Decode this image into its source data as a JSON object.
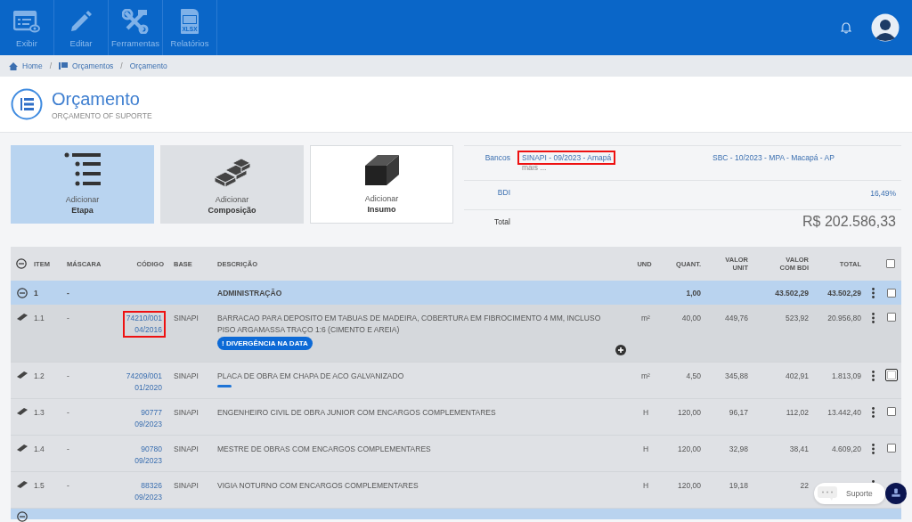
{
  "toolbar": [
    {
      "label": "Exibir",
      "kind": "view"
    },
    {
      "label": "Editar",
      "kind": "edit"
    },
    {
      "label": "Ferramentas",
      "kind": "tools"
    },
    {
      "label": "Relatórios",
      "kind": "xlsx",
      "icon_text": "XLSX"
    }
  ],
  "breadcrumb": [
    {
      "label": "Home",
      "kind": "home"
    },
    {
      "separator": "/",
      "label": "Orçamentos",
      "kind": "list"
    },
    {
      "separator": "/",
      "label": "Orçamento",
      "kind": "none"
    }
  ],
  "header": {
    "title": "Orçamento",
    "subtitle": "ORÇAMENTO OF SUPORTE"
  },
  "add_cards": [
    {
      "label": "Adicionar",
      "strong": "Etapa",
      "kind": "stage",
      "selected": true
    },
    {
      "label": "Adicionar",
      "strong": "Composição",
      "kind": "bricks",
      "selected": false
    },
    {
      "label": "Adicionar",
      "strong": "Insumo",
      "kind": "block",
      "selected": false
    }
  ],
  "info": {
    "bancos_label": "Bancos",
    "bancos": [
      {
        "text": "SINAPI - 09/2023 - Amapá",
        "marked": true
      },
      {
        "text": "SBC - 10/2023 - MPA - Macapá - AP",
        "marked": false
      }
    ],
    "more": "mais ...",
    "bdi_label": "BDI",
    "bdi": "16,49%",
    "total_label": "Total",
    "total": "R$ 202.586,33"
  },
  "table": {
    "columns": [
      "ITEM",
      "MÁSCARA",
      "CÓDIGO",
      "BASE",
      "DESCRIÇÃO",
      "UND",
      "QUANT.",
      "VALOR UNIT",
      "VALOR COM BDI",
      "TOTAL"
    ],
    "header_checked": false,
    "rows": [
      {
        "kind": "group",
        "item": "1",
        "mask": "-",
        "description": "ADMINISTRAÇÃO",
        "quant": "1,00",
        "value_bdi": "43.502,29",
        "total": "43.502,29",
        "checked": false
      },
      {
        "kind": "item",
        "item": "1.1",
        "mask": "-",
        "code": "74210/001",
        "date": "04/2016",
        "code_marked": true,
        "base": "SINAPI",
        "description": "BARRACAO PARA DEPOSITO EM TABUAS DE MADEIRA, COBERTURA EM FIBROCIMENTO 4 MM, INCLUSO PISO ARGAMASSA TRAÇO 1:6 (CIMENTO E AREIA)",
        "badge": "! DIVERGÊNCIA NA DATA",
        "unit": "m²",
        "quant": "40,00",
        "value_unit": "449,76",
        "value_bdi": "523,92",
        "total": "20.956,80",
        "highlighted": true,
        "checked": false,
        "focused": false
      },
      {
        "kind": "item",
        "item": "1.2",
        "mask": "-",
        "code": "74209/001",
        "date": "01/2020",
        "code_marked": false,
        "base": "SINAPI",
        "description": "PLACA DE OBRA EM CHAPA DE ACO GALVANIZADO",
        "indicator": true,
        "unit": "m²",
        "quant": "4,50",
        "value_unit": "345,88",
        "value_bdi": "402,91",
        "total": "1.813,09",
        "highlighted": false,
        "checked": false,
        "focused": true
      },
      {
        "kind": "item",
        "item": "1.3",
        "mask": "-",
        "code": "90777",
        "date": "09/2023",
        "code_marked": false,
        "base": "SINAPI",
        "description": "ENGENHEIRO CIVIL DE OBRA JUNIOR COM ENCARGOS COMPLEMENTARES",
        "unit": "H",
        "quant": "120,00",
        "value_unit": "96,17",
        "value_bdi": "112,02",
        "total": "13.442,40",
        "highlighted": false,
        "checked": false,
        "focused": false
      },
      {
        "kind": "item",
        "item": "1.4",
        "mask": "-",
        "code": "90780",
        "date": "09/2023",
        "code_marked": false,
        "base": "SINAPI",
        "description": "MESTRE DE OBRAS COM ENCARGOS COMPLEMENTARES",
        "unit": "H",
        "quant": "120,00",
        "value_unit": "32,98",
        "value_bdi": "38,41",
        "total": "4.609,20",
        "highlighted": false,
        "checked": false,
        "focused": false
      },
      {
        "kind": "item",
        "item": "1.5",
        "mask": "-",
        "code": "88326",
        "date": "09/2023",
        "code_marked": false,
        "base": "SINAPI",
        "description": "VIGIA NOTURNO COM ENCARGOS COMPLEMENTARES",
        "unit": "H",
        "quant": "120,00",
        "value_unit": "19,18",
        "value_bdi": "22",
        "highlighted": false
      },
      {
        "kind": "group_cut"
      }
    ]
  },
  "support": {
    "label": "Suporte"
  }
}
